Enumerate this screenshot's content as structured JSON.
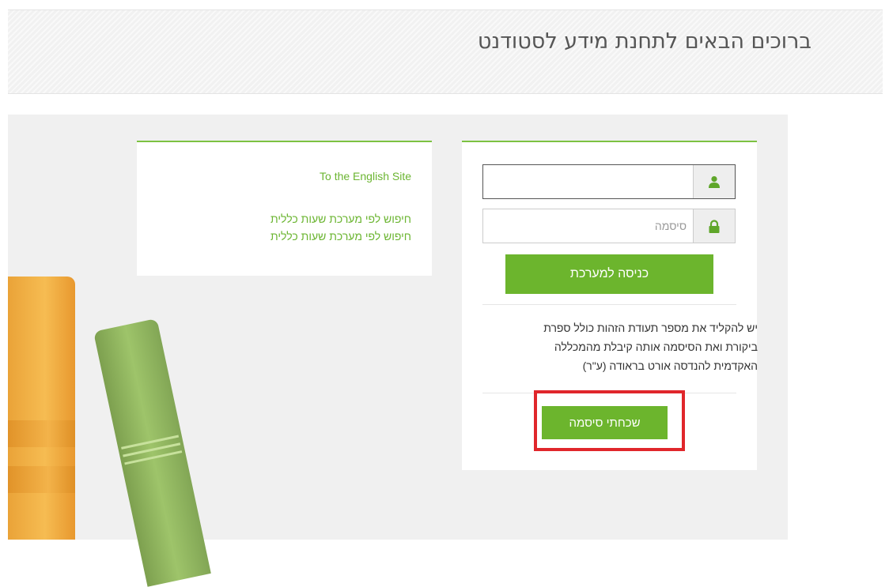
{
  "header": {
    "title": "ברוכים הבאים לתחנת מידע לסטודנט"
  },
  "links_panel": {
    "english_site": "To the English Site",
    "search_link_1": "חיפוש לפי מערכת שעות כללית",
    "search_link_2": "חיפוש לפי מערכת שעות כללית"
  },
  "login": {
    "username_value": "",
    "password_placeholder": "סיסמה",
    "submit_label": "כניסה למערכת",
    "info_lines": [
      "יש להקליד את מספר תעודת הזהות כולל ספרת",
      "ביקורת ואת הסיסמה אותה קיבלת מהמכללה",
      "האקדמית להנדסה אורט בראודה (ע\"ר)"
    ],
    "forgot_password_label": "שכחתי סיסמה"
  },
  "icons": {
    "username": "user-icon",
    "password": "lock-icon"
  },
  "colors": {
    "accent_green": "#6cb52d",
    "link_green": "#6bb531",
    "highlight_red": "#e0262b"
  }
}
